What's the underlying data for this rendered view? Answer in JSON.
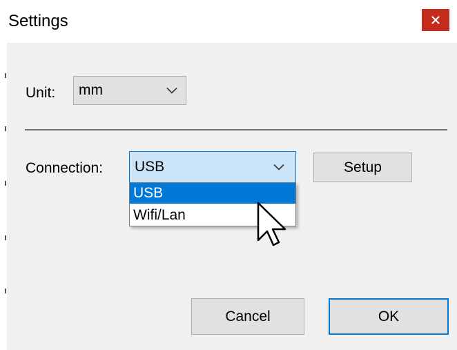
{
  "window": {
    "title": "Settings",
    "close_glyph": "x"
  },
  "unit": {
    "label": "Unit:",
    "selected": "mm"
  },
  "connection": {
    "label": "Connection:",
    "selected": "USB",
    "options": [
      "USB",
      "Wifi/Lan"
    ],
    "highlighted_option": "USB"
  },
  "buttons": {
    "setup": "Setup",
    "cancel": "Cancel",
    "ok": "OK"
  },
  "icons": {
    "close": "close-icon",
    "chevron": "chevron-down-icon",
    "cursor": "mouse-pointer-icon"
  },
  "colors": {
    "close_button": "#c42b1c",
    "accent": "#0078d7",
    "focused_combo": "#cce4f7",
    "dialog_background": "#f0f0f0"
  }
}
